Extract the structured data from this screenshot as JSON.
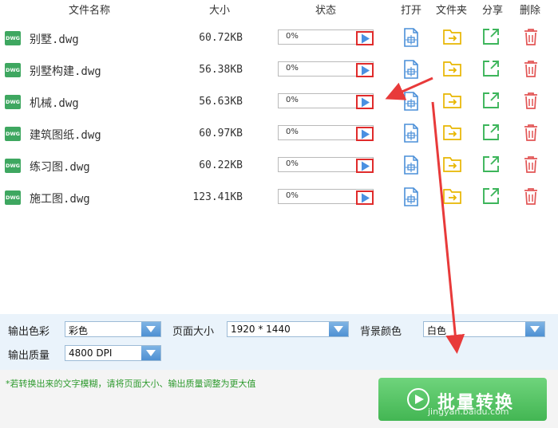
{
  "header": {
    "name": "文件名称",
    "size": "大小",
    "status": "状态",
    "open": "打开",
    "folder": "文件夹",
    "share": "分享",
    "delete": "删除"
  },
  "files": [
    {
      "icon_label": "DWG",
      "name": "别墅.dwg",
      "size": "60.72KB",
      "progress_text": "0%",
      "progress": 0
    },
    {
      "icon_label": "DWG",
      "name": "别墅构建.dwg",
      "size": "56.38KB",
      "progress_text": "0%",
      "progress": 0
    },
    {
      "icon_label": "DWG",
      "name": "机械.dwg",
      "size": "56.63KB",
      "progress_text": "0%",
      "progress": 0
    },
    {
      "icon_label": "DWG",
      "name": "建筑图纸.dwg",
      "size": "60.97KB",
      "progress_text": "0%",
      "progress": 0
    },
    {
      "icon_label": "DWG",
      "name": "练习图.dwg",
      "size": "60.22KB",
      "progress_text": "0%",
      "progress": 0
    },
    {
      "icon_label": "DWG",
      "name": "施工图.dwg",
      "size": "123.41KB",
      "progress_text": "0%",
      "progress": 0
    }
  ],
  "icons": {
    "file_type": "dwg-file-icon",
    "start": "play-icon",
    "open": "open-file-icon",
    "folder": "folder-arrow-icon",
    "share": "share-icon",
    "delete": "trash-icon"
  },
  "settings": {
    "color_label": "输出色彩",
    "color_value": "彩色",
    "page_size_label": "页面大小",
    "page_size_value": "1920 * 1440",
    "bg_label": "背景颜色",
    "bg_value": "白色",
    "quality_label": "输出质量",
    "quality_value": "4800 DPI"
  },
  "footer": {
    "tip": "*若转换出来的文字模糊，请将页面大小、输出质量调整为更大值",
    "convert_label": "批量转换",
    "watermark": "jingyan.baidu.com"
  },
  "colors": {
    "accent_green": "#43b653",
    "tip_green": "#2e9a2e",
    "highlight_red": "#e02b2b",
    "play_blue": "#4a90e2",
    "open_blue": "#4a8fd8",
    "folder_yellow": "#e8b600",
    "share_green": "#3cb55a",
    "delete_red": "#e25555",
    "settings_bg": "#eaf3fb"
  }
}
